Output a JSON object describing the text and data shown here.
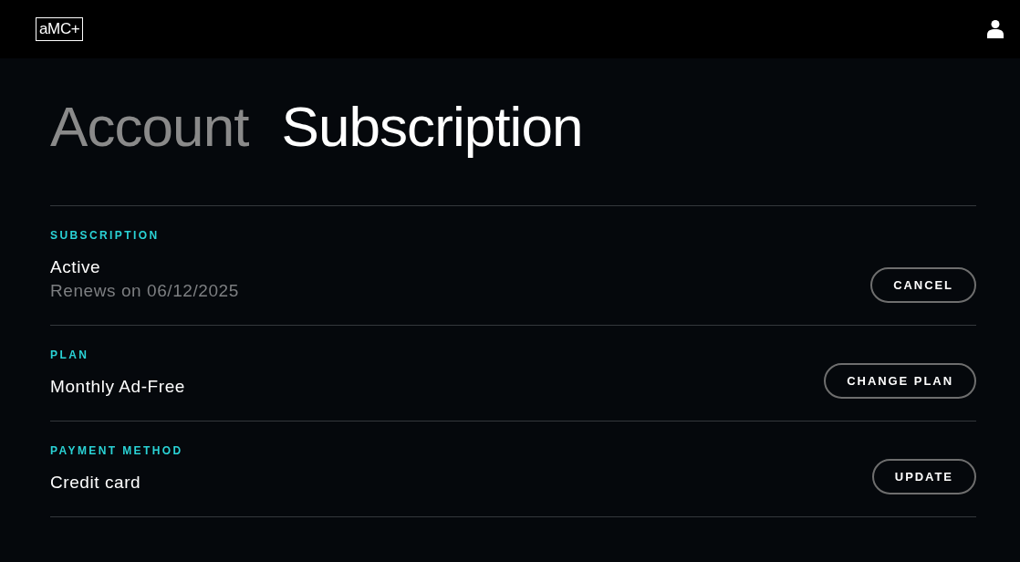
{
  "header": {
    "logo": "aMC+"
  },
  "title": [
    {
      "label": "Account",
      "selected": false
    },
    {
      "label": "Subscription",
      "selected": true
    }
  ],
  "sections": [
    {
      "heading": "SUBSCRIPTION",
      "value": "Active",
      "detail": "Renews on 06/12/2025",
      "button": "CANCEL"
    },
    {
      "heading": "PLAN",
      "value": "Monthly Ad-Free",
      "button": "CHANGE PLAN"
    },
    {
      "heading": "PAYMENT METHOD",
      "value": "Credit card",
      "button": "UPDATE"
    }
  ]
}
